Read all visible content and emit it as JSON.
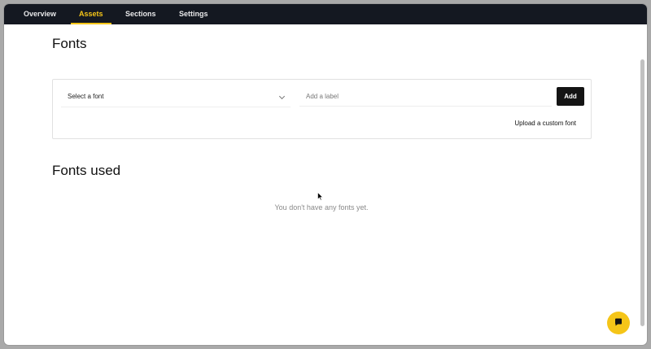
{
  "nav": {
    "tabs": [
      {
        "label": "Overview"
      },
      {
        "label": "Assets"
      },
      {
        "label": "Sections"
      },
      {
        "label": "Settings"
      }
    ],
    "active_tab": "Assets"
  },
  "fonts": {
    "title": "Fonts",
    "select_value": "Select a font",
    "label_placeholder": "Add a label",
    "label_value": "",
    "add_label": "Add",
    "upload_link": "Upload a custom font"
  },
  "fonts_used": {
    "title": "Fonts used",
    "empty_text": "You don't have any fonts yet."
  },
  "icons": {
    "select_chevron": "chevron-down-icon",
    "chat": "chat-bubble-icon",
    "cursor": "mouse-pointer-icon"
  },
  "colors": {
    "nav_background": "#141821",
    "accent": "#f5c518",
    "button_background": "#141414"
  }
}
